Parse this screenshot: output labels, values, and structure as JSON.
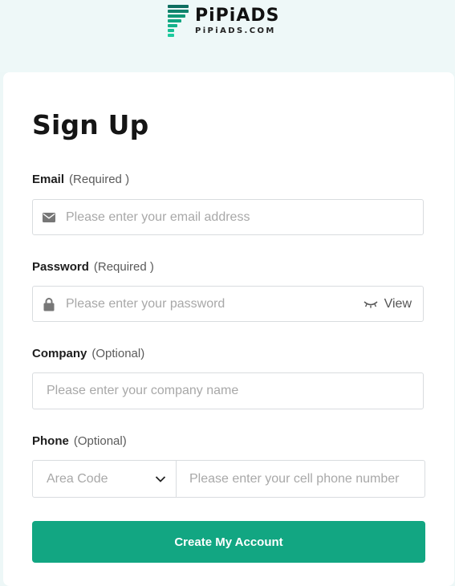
{
  "brand": {
    "name": "PiPiADS",
    "domain": "PiPiADS.COM",
    "accent_color": "#12a682"
  },
  "form": {
    "title": "Sign Up",
    "email": {
      "label": "Email",
      "qualifier": "(Required )",
      "placeholder": "Please enter your email address",
      "value": "",
      "icon": "mail-icon"
    },
    "password": {
      "label": "Password",
      "qualifier": "(Required )",
      "placeholder": "Please enter your password",
      "value": "",
      "icon": "lock-icon",
      "toggle_label": "View",
      "toggle_icon": "closed-eye-icon"
    },
    "company": {
      "label": "Company",
      "qualifier": "(Optional)",
      "placeholder": "Please enter your company name",
      "value": ""
    },
    "phone": {
      "label": "Phone",
      "qualifier": "(Optional)",
      "area_code_placeholder": "Area Code",
      "area_code_icon": "chevron-down-icon",
      "placeholder": "Please enter your cell phone number",
      "value": ""
    },
    "submit_label": "Create My Account"
  }
}
